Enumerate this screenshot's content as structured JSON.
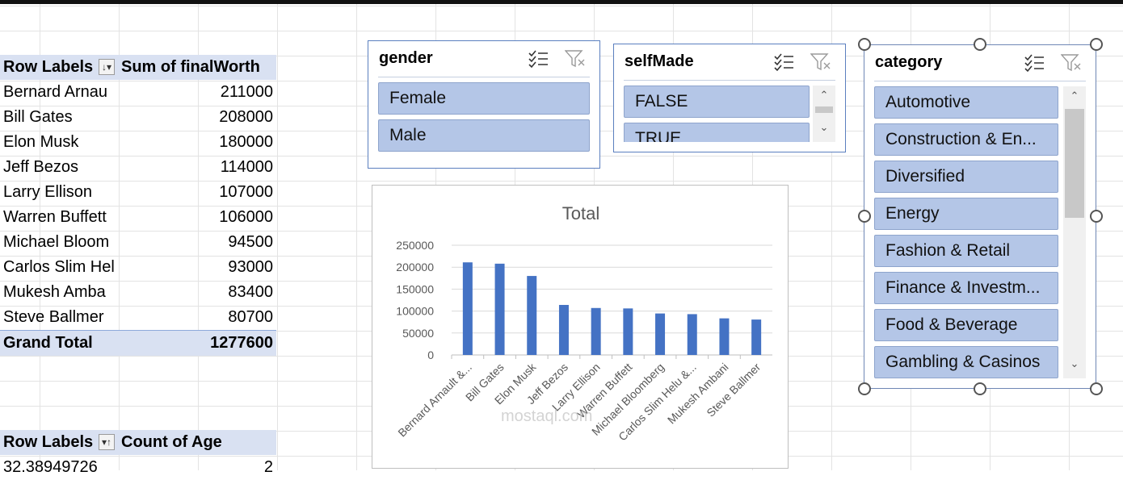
{
  "pivot1": {
    "header_label": "Row Labels",
    "header_value": "Sum of finalWorth",
    "rows": [
      {
        "label": "Bernard Arnau",
        "value": "211000"
      },
      {
        "label": "Bill Gates",
        "value": "208000"
      },
      {
        "label": "Elon Musk",
        "value": "180000"
      },
      {
        "label": "Jeff Bezos",
        "value": "114000"
      },
      {
        "label": "Larry Ellison",
        "value": "107000"
      },
      {
        "label": "Warren Buffett",
        "value": "106000"
      },
      {
        "label": "Michael Bloom",
        "value": "94500"
      },
      {
        "label": "Carlos Slim Hel",
        "value": "93000"
      },
      {
        "label": "Mukesh Amba",
        "value": "83400"
      },
      {
        "label": "Steve Ballmer",
        "value": "80700"
      }
    ],
    "total_label": "Grand Total",
    "total_value": "1277600"
  },
  "pivot2": {
    "header_label": "Row Labels",
    "header_value": "Count of Age",
    "first_row_label": "32.38949726",
    "first_row_value": "2"
  },
  "slicers": {
    "gender": {
      "title": "gender",
      "items": [
        "Female",
        "Male"
      ]
    },
    "selfmade": {
      "title": "selfMade",
      "items": [
        "FALSE",
        "TRUE"
      ]
    },
    "category": {
      "title": "category",
      "items": [
        "Automotive",
        "Construction & En...",
        "Diversified",
        "Energy",
        "Fashion & Retail",
        "Finance & Investm...",
        "Food & Beverage",
        "Gambling & Casinos"
      ]
    }
  },
  "icons": {
    "multi_select": "multi-select-icon",
    "clear_filter": "clear-filter-icon"
  },
  "colors": {
    "bar": "#4472c4",
    "slicer_item": "#b4c6e7",
    "pivot_header": "#d9e1f2"
  },
  "watermark": "mostaql.com",
  "chart_data": {
    "type": "bar",
    "title": "Total",
    "categories": [
      "Bernard Arnault &...",
      "Bill Gates",
      "Elon Musk",
      "Jeff Bezos",
      "Larry Ellison",
      "Warren Buffett",
      "Michael Bloomberg",
      "Carlos Slim Helu &...",
      "Mukesh Ambani",
      "Steve Ballmer"
    ],
    "values": [
      211000,
      208000,
      180000,
      114000,
      107000,
      106000,
      94500,
      93000,
      83400,
      80700
    ],
    "ylim": [
      0,
      250000
    ],
    "yticks": [
      0,
      50000,
      100000,
      150000,
      200000,
      250000
    ],
    "grid": true
  }
}
